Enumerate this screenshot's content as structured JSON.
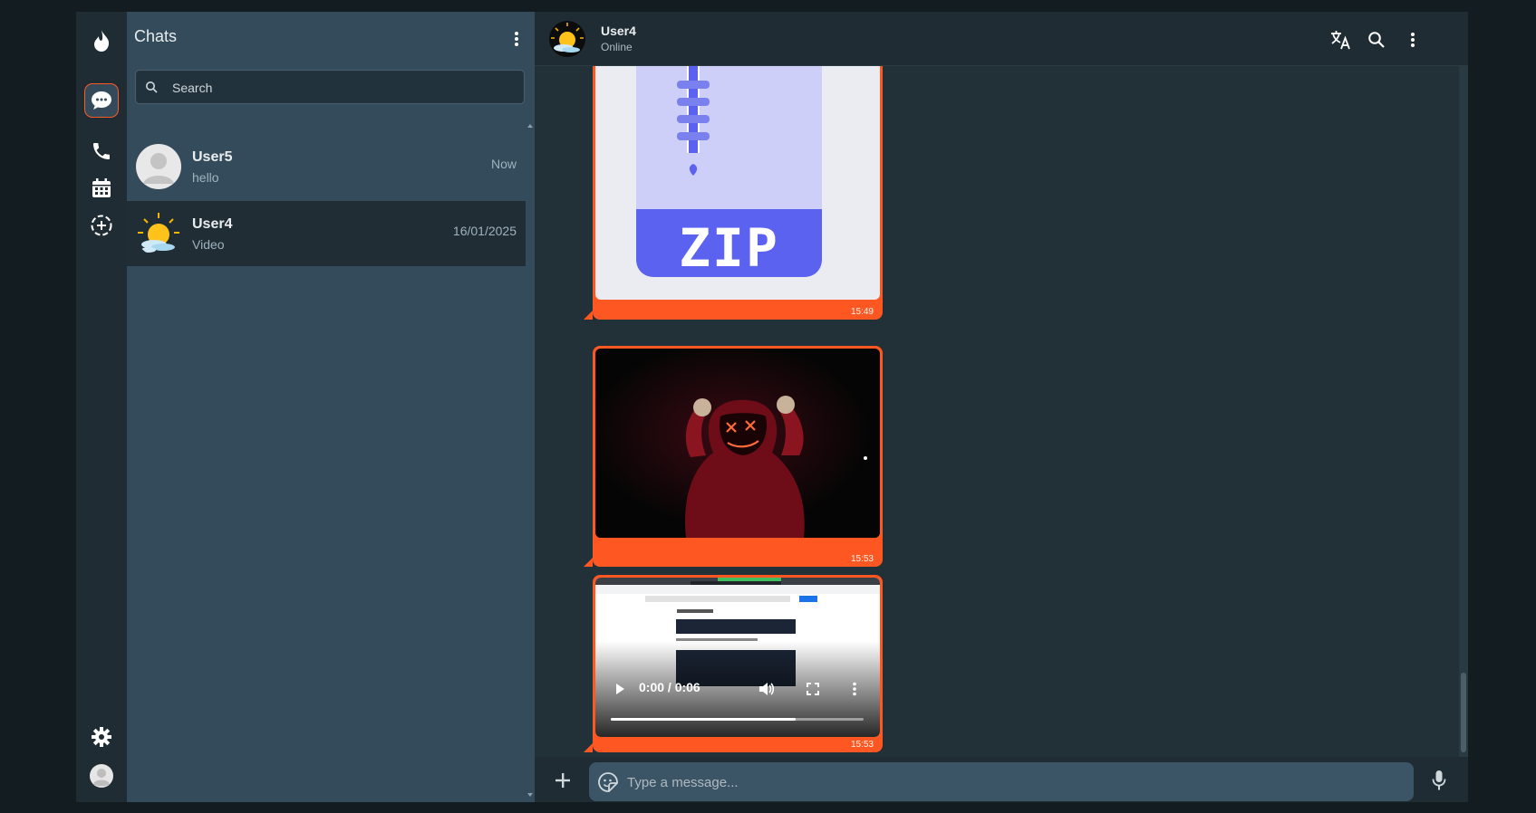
{
  "sidebar": {
    "nav": [
      {
        "name": "chats",
        "icon": "chat-bubble-icon",
        "active": true
      },
      {
        "name": "calls",
        "icon": "phone-icon"
      },
      {
        "name": "calendar",
        "icon": "calendar-icon"
      },
      {
        "name": "status",
        "icon": "status-add-icon"
      }
    ],
    "bottom": [
      {
        "name": "settings",
        "icon": "gear-icon"
      },
      {
        "name": "profile",
        "icon": "avatar-icon"
      }
    ],
    "logo_icon": "flame-icon"
  },
  "chat_list": {
    "title": "Chats",
    "search_placeholder": "Search",
    "chats": [
      {
        "name": "User5",
        "preview": "hello",
        "time": "Now",
        "avatar": "default-avatar-icon"
      },
      {
        "name": "User4",
        "preview": "Video",
        "time": "16/01/2025",
        "avatar": "sun-cloud-icon",
        "selected": true
      }
    ]
  },
  "conversation": {
    "contact_name": "User4",
    "contact_status": "Online",
    "header_icons": [
      "translate-icon",
      "search-icon",
      "more-vertical-icon"
    ],
    "messages": [
      {
        "type": "file",
        "file_label": "ZIP",
        "time": "15:49"
      },
      {
        "type": "image",
        "time": "15:53"
      },
      {
        "type": "video",
        "player_time": "0:00 / 0:06",
        "time": "15:53"
      }
    ],
    "composer_placeholder": "Type a message..."
  },
  "colors": {
    "accent": "#ff5722",
    "panel": "#344b5b",
    "background": "#223038"
  }
}
